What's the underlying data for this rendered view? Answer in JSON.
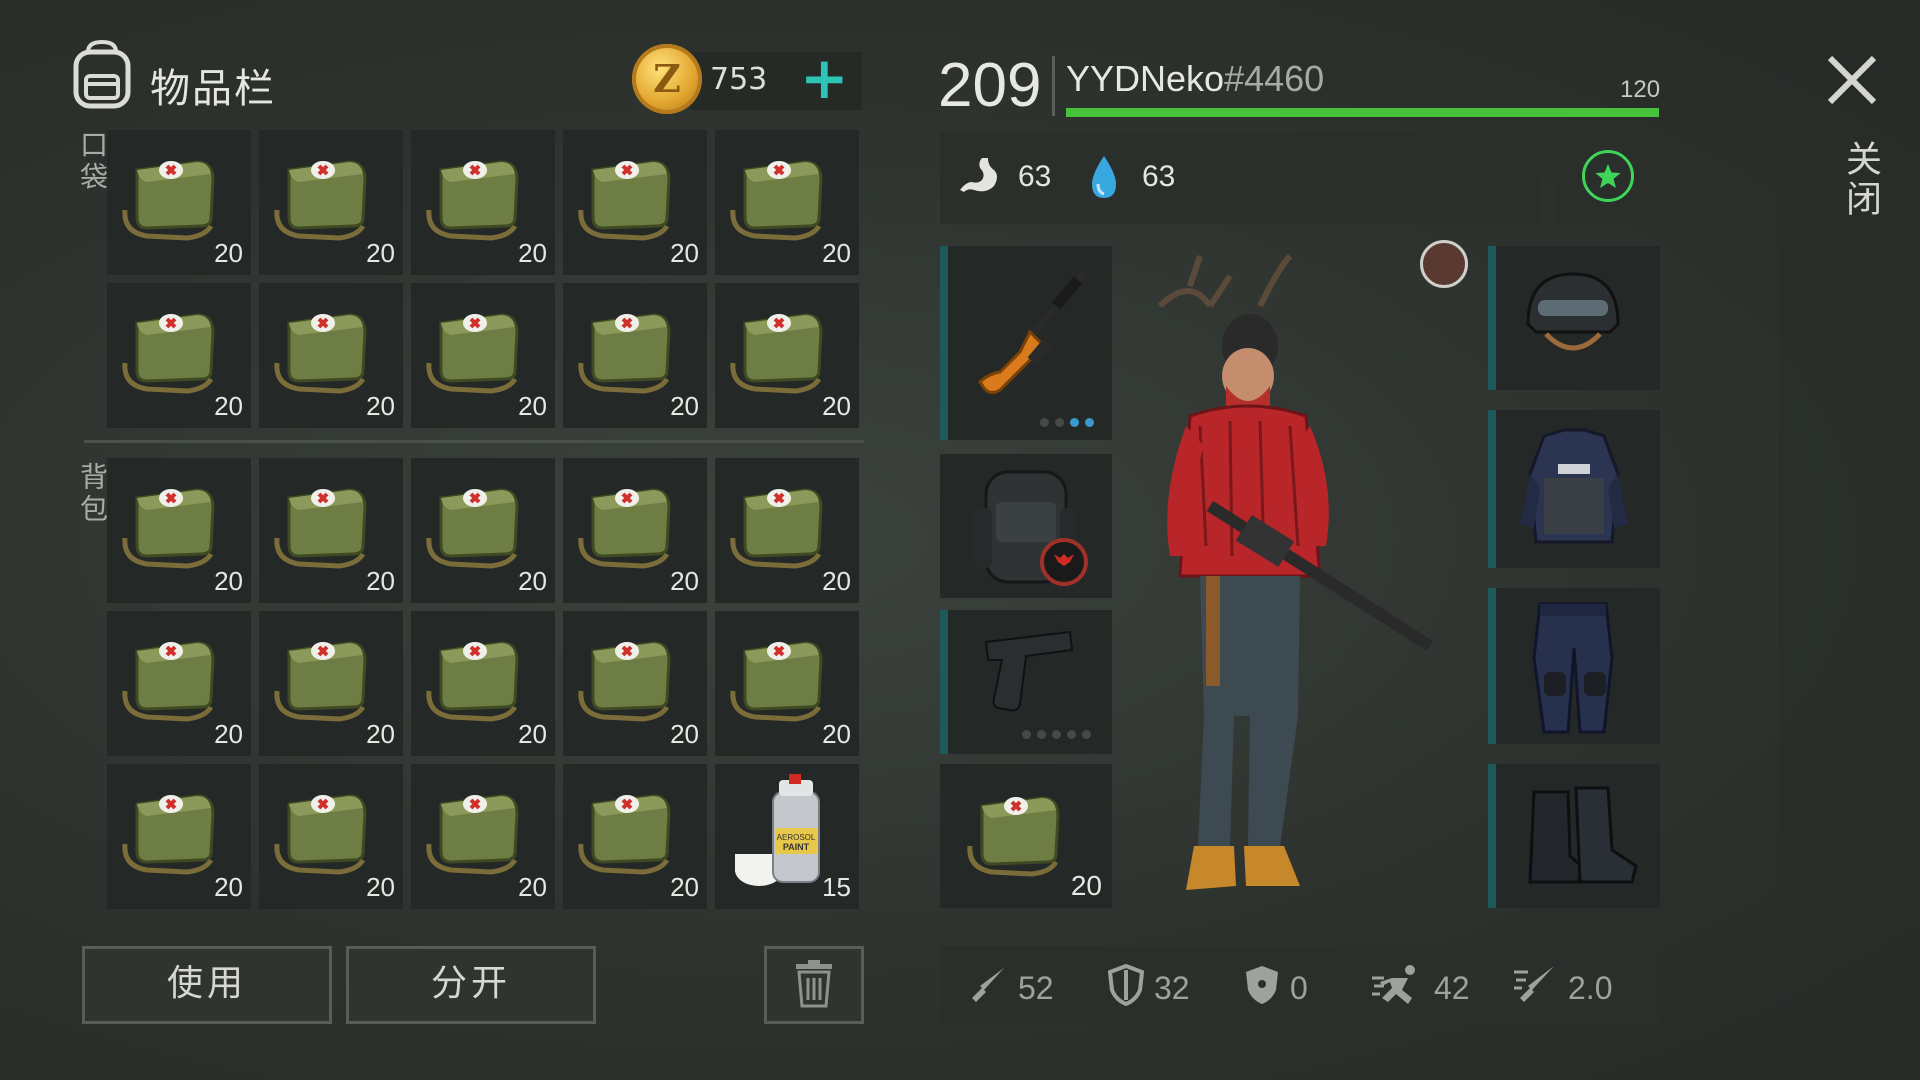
{
  "inventory": {
    "title": "物品栏",
    "coins": "753",
    "pocket_label": "口袋",
    "bag_label": "背包",
    "pocket_items": [
      {
        "icon": "medkit-bag-icon",
        "qty": "20"
      },
      {
        "icon": "medkit-bag-icon",
        "qty": "20"
      },
      {
        "icon": "medkit-bag-icon",
        "qty": "20"
      },
      {
        "icon": "medkit-bag-icon",
        "qty": "20"
      },
      {
        "icon": "medkit-bag-icon",
        "qty": "20"
      },
      {
        "icon": "medkit-bag-icon",
        "qty": "20"
      },
      {
        "icon": "medkit-bag-icon",
        "qty": "20"
      },
      {
        "icon": "medkit-bag-icon",
        "qty": "20"
      },
      {
        "icon": "medkit-bag-icon",
        "qty": "20"
      },
      {
        "icon": "medkit-bag-icon",
        "qty": "20"
      }
    ],
    "bag_items": [
      {
        "icon": "medkit-bag-icon",
        "qty": "20"
      },
      {
        "icon": "medkit-bag-icon",
        "qty": "20"
      },
      {
        "icon": "medkit-bag-icon",
        "qty": "20"
      },
      {
        "icon": "medkit-bag-icon",
        "qty": "20"
      },
      {
        "icon": "medkit-bag-icon",
        "qty": "20"
      },
      {
        "icon": "medkit-bag-icon",
        "qty": "20"
      },
      {
        "icon": "medkit-bag-icon",
        "qty": "20"
      },
      {
        "icon": "medkit-bag-icon",
        "qty": "20"
      },
      {
        "icon": "medkit-bag-icon",
        "qty": "20"
      },
      {
        "icon": "medkit-bag-icon",
        "qty": "20"
      },
      {
        "icon": "medkit-bag-icon",
        "qty": "20"
      },
      {
        "icon": "medkit-bag-icon",
        "qty": "20"
      },
      {
        "icon": "medkit-bag-icon",
        "qty": "20"
      },
      {
        "icon": "medkit-bag-icon",
        "qty": "20"
      },
      {
        "icon": "spray-paint-icon",
        "qty": "15",
        "text": "AEROSOL PAINT"
      }
    ],
    "buttons": {
      "use": "使用",
      "split": "分开"
    }
  },
  "player": {
    "level": "209",
    "name": "YYDNeko",
    "tag": "#4460",
    "xp_max": "120",
    "xp_fraction": 1.0,
    "hunger": "63",
    "thirst": "63",
    "quick_slot_qty": "20",
    "stats": {
      "attack": "52",
      "defense": "32",
      "armor": "0",
      "speed": "42",
      "attack_speed": "2.0"
    }
  },
  "close_label": "关闭",
  "colors": {
    "accent_green": "#46c33a",
    "accent_teal": "#2dc4b6",
    "slot_bg": "#242826"
  }
}
